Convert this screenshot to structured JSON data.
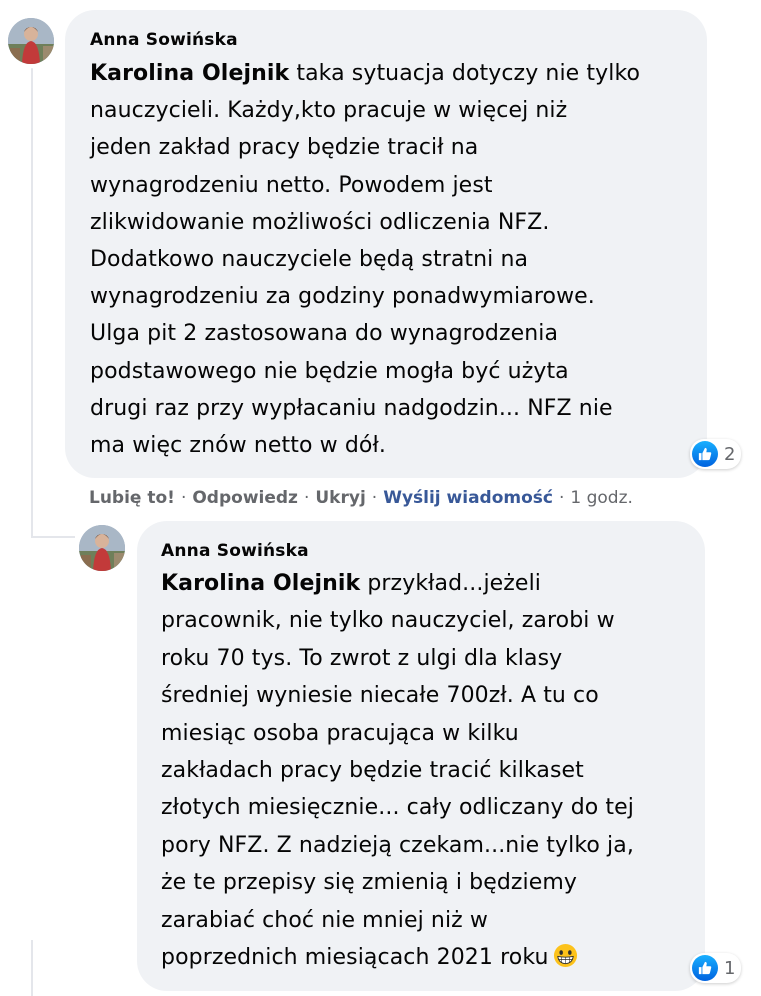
{
  "comments": [
    {
      "author": "Anna Sowińska",
      "mention": "Karolina Olejnik",
      "text": " taka sytuacja dotyczy nie tylko\nnauczycieli. Każdy,kto pracuje w więcej niż\njeden zakład pracy będzie tracił na\nwynagrodzeniu netto. Powodem jest\nzlikwidowanie możliwości odliczenia NFZ.\nDodatkowo nauczyciele będą stratni na\nwynagrodzeniu za godziny ponadwymiarowe.\nUlga pit 2 zastosowana do wynagrodzenia\npodstawowego nie będzie mogła być użyta\ndrugi raz przy wypłacaniu nadgodzin... NFZ nie\nma więc znów netto w dół.",
      "reaction_icon": "like-icon",
      "reaction_count": "2",
      "actions": {
        "like": "Lubię to!",
        "reply": "Odpowiedz",
        "hide": "Ukryj",
        "message": "Wyślij wiadomość",
        "time": "1 godz."
      },
      "separator": "·"
    },
    {
      "author": "Anna Sowińska",
      "mention": "Karolina Olejnik",
      "text": " przykład...jeżeli\npracownik, nie tylko nauczyciel, zarobi w\nroku 70 tys. To zwrot z ulgi dla klasy\nśredniej wyniesie niecałe 700zł. A tu co\nmiesiąc osoba pracująca w kilku\nzakładach pracy będzie tracić kilkaset\nzłotych miesięcznie... cały odliczany do tej\npory NFZ. Z nadzieją czekam...nie tylko ja,\nże te przepisy się zmienią i będziemy\nzarabiać choć nie mniej niż w\npoprzednich miesiącach 2021 roku",
      "emoji": "grinning-face-icon",
      "reaction_icon": "like-icon",
      "reaction_count": "1"
    }
  ],
  "colors": {
    "bubble": "#f0f2f5",
    "action_text": "#65676b",
    "send_message": "#385898",
    "like_blue": "#1877f2"
  }
}
